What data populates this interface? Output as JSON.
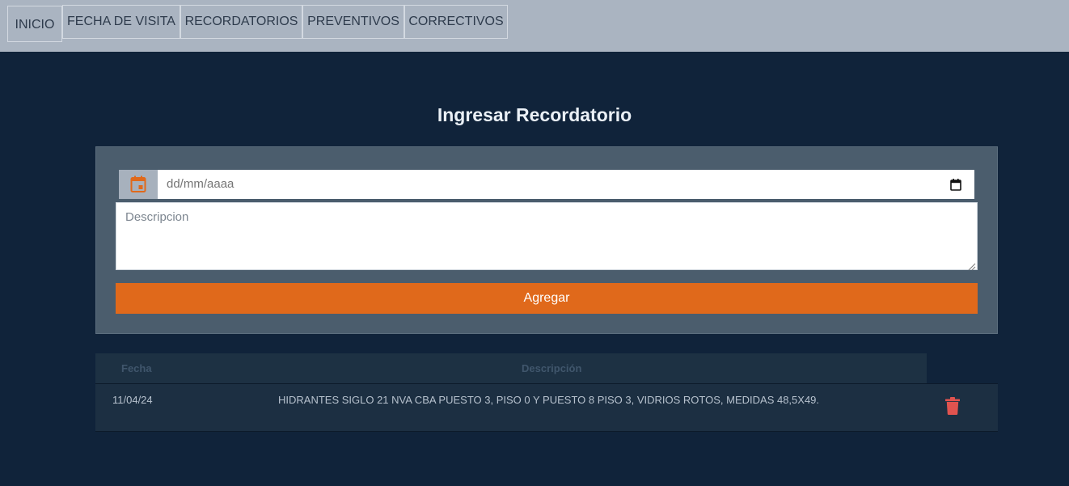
{
  "nav": {
    "items": [
      {
        "label": "INICIO"
      },
      {
        "label": "FECHA DE VISITA"
      },
      {
        "label": "RECORDATORIOS"
      },
      {
        "label": "PREVENTIVOS"
      },
      {
        "label": "CORRECTIVOS"
      }
    ],
    "active": "INICIO"
  },
  "page": {
    "title": "Ingresar Recordatorio"
  },
  "form": {
    "date_placeholder": "dd/mm/aaaa",
    "date_value": "",
    "description_placeholder": "Descripcion",
    "description_value": "",
    "submit_label": "Agregar",
    "icons": {
      "date_addon": "calendar-icon",
      "date_picker": "calendar-picker-icon"
    }
  },
  "table": {
    "headers": {
      "fecha": "Fecha",
      "descripcion": "Descripción"
    },
    "rows": [
      {
        "fecha": "11/04/24",
        "descripcion": "HIDRANTES SIGLO 21 NVA CBA PUESTO 3, PISO 0 Y PUESTO 8 PISO 3, VIDRIOS ROTOS, MEDIDAS 48,5X49.",
        "action_icon": "trash-icon"
      }
    ]
  },
  "colors": {
    "background": "#10233a",
    "nav_background": "#aab4c1",
    "panel": "#4b5d6d",
    "accent": "#e0691b",
    "delete": "#e0534f"
  }
}
